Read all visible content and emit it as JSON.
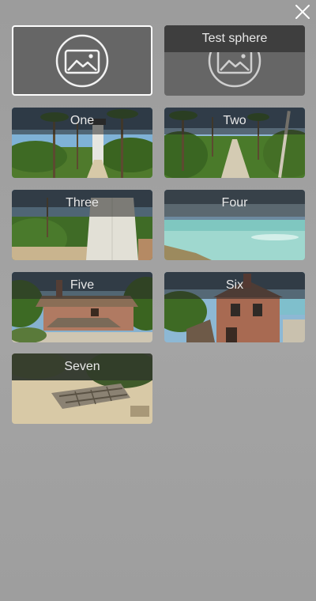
{
  "close_icon": "close-x-icon",
  "placeholder_icon": "image-icon",
  "colors": {
    "selected_border": "#ffffff",
    "background": "#a0a0a0",
    "tile_label_band": "#3e3e3e"
  },
  "scenes": [
    {
      "label": "",
      "selected": true,
      "thumbnail": "placeholder"
    },
    {
      "label": "Test sphere",
      "selected": false,
      "thumbnail": "placeholder"
    },
    {
      "label": "One",
      "selected": false,
      "thumbnail": "lighthouse-palms"
    },
    {
      "label": "Two",
      "selected": false,
      "thumbnail": "palm-path"
    },
    {
      "label": "Three",
      "selected": false,
      "thumbnail": "lighthouse-base"
    },
    {
      "label": "Four",
      "selected": false,
      "thumbnail": "beach-sea"
    },
    {
      "label": "Five",
      "selected": false,
      "thumbnail": "cottage"
    },
    {
      "label": "Six",
      "selected": false,
      "thumbnail": "brick-house"
    },
    {
      "label": "Seven",
      "selected": false,
      "thumbnail": "shipwreck"
    }
  ]
}
